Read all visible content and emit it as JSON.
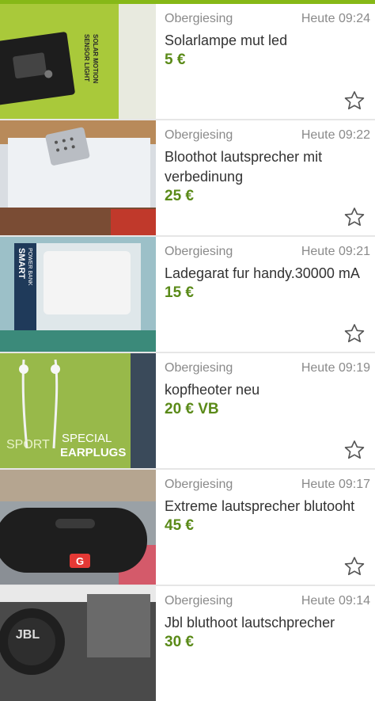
{
  "accent_color": "#86b817",
  "price_color": "#5a8a18",
  "favorite_icon": "star-outline-icon",
  "listings": [
    {
      "location": "Obergiesing",
      "time": "Heute 09:24",
      "title": "Solarlampe mut led",
      "price": "5 €",
      "thumb_text": [
        "SOLAR MOTION",
        "SENSOR LIGHT"
      ]
    },
    {
      "location": "Obergiesing",
      "time": "Heute 09:22",
      "title": "Bloothot lautsprecher mit verbedinung",
      "price": "25 €",
      "thumb_text": []
    },
    {
      "location": "Obergiesing",
      "time": "Heute 09:21",
      "title": "Ladegarat fur handy.30000 mA",
      "price": "15 €",
      "thumb_text": [
        "SMART",
        "POWER BANK"
      ]
    },
    {
      "location": "Obergiesing",
      "time": "Heute 09:19",
      "title": "kopfheoter neu",
      "price": "20 € VB",
      "thumb_text": [
        "SPORT",
        "SPECIAL",
        "EARPLUGS"
      ]
    },
    {
      "location": "Obergiesing",
      "time": "Heute 09:17",
      "title": "Extreme lautsprecher blutooht",
      "price": "45 €",
      "thumb_text": [
        "G"
      ]
    },
    {
      "location": "Obergiesing",
      "time": "Heute 09:14",
      "title": "Jbl bluthoot lautschprecher",
      "price": "30 €",
      "thumb_text": [
        "JBL"
      ]
    }
  ]
}
